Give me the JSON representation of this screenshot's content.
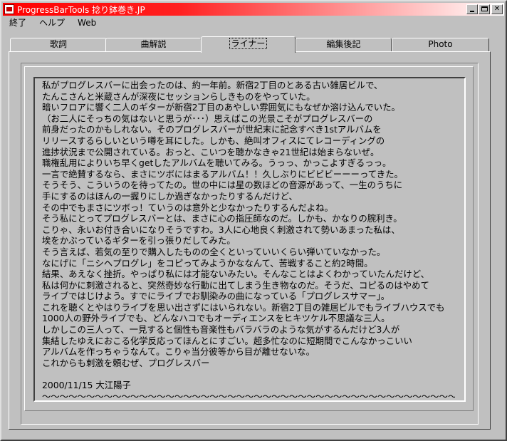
{
  "window": {
    "title": "ProgressBarTools 捻り鉢巻き.JP"
  },
  "menu": [
    "終了",
    "ヘルプ",
    "Web"
  ],
  "tabs": [
    "歌詞",
    "曲解説",
    "ライナー",
    "編集後記",
    "Photo"
  ],
  "active_tab": "ライナー",
  "liner": {
    "lines": [
      "私がプログレスバーに出会ったのは、約一年前。新宿2丁目のとある古い雑居ビルで、",
      "たんこさんと米蔵さんが深夜にセッションらしきものをやっていた。",
      "暗いフロアに響く二人のギターが新宿2丁目のあやしい雰囲気にもなぜか溶け込んでいた。",
      "（お二人にそっちの気はないと思うが･･･）思えばこの光景こそがプログレスバーの",
      "前身だったのかもしれない。そのプログレスバーが世紀末に記念すべき1stアルバムを",
      "リリースするらしいという噂を耳にした。しかも、絶叫オフィスにてレコーディングの",
      "進捗状況まで公開されている。おっと、こいつを聴かなきゃ21世紀は始まらないぜ。",
      "職権乱用によりいち早くgetしたアルバムを聴いてみる。うっっ、かっこよすぎるっっ。",
      "一言で絶賛するなら、まさにツボにはまるアルバム！！久しぶりにビビビーーーってきた。",
      "そうそう、こういうのを待ってたの。世の中には星の数ほどの音源があって、一生のうちに",
      "手にするのはほんの一握りにしか過ぎなかったりするんだけど、",
      "その中でもまさにツボっ！ていうのは意外と少なかったりするんだよね。",
      "そう私にとってプログレスバーとは、まさに心の指圧師なのだ。しかも、かなりの腕利き。",
      "こりゃ、永いお付き合いになりそうですわ。3人に心地良く刺激されて勢いあまった私は、",
      "埃をかぶっているギターを引っ張りだしてみた。",
      "そう言えば、若気の至りで購入したものの全くといっていいくらい弾いていなかった。",
      "なにげに「ニシヘプログレ」をコピってみようかななんて、苦戦すること約2時間。",
      "結果、あえなく挫折。やっぱり私には才能ないみたい。そんなことはよくわかっていたんだけど、",
      "私は何かに刺激されると、突然奇妙な行動に出てしまう生き物なのだ。そうだ、コピるのはやめて",
      "ライブではじけよう。すでにライブでお馴染みの曲になっている「プログレスサマー」。",
      "これを聴くとやはりライブを思い出さずにはいられない。新宿2丁目の雑居ビルでもライブハウスでも",
      "1000人の野外ライブでも、どんなハコでもオーディエンスをヒキツケル不思議な三人。",
      "しかしこの三人って、一見すると個性も音楽性もバラバラのような気がするんだけど3人が",
      "集結したゆえにおこる化学反応ってほんとにすごい。超多忙なのに短期間でこんなかっこいい",
      "アルバムを作っちゃうなんて。こりゃ当分彼等から目が離せないな。",
      "これからも刺激を頼むぜ、プログレスバー"
    ],
    "signature": "2000/11/15 大江陽子",
    "rule": "～～～～～～～～～～～～～～～～～～～～～～～～～～～～～～～～～～～～～～～～～～～～～～～～"
  },
  "colors": {
    "title_start": "#ff0000",
    "title_end": "#ffffff",
    "face": "#c0c0c0"
  }
}
